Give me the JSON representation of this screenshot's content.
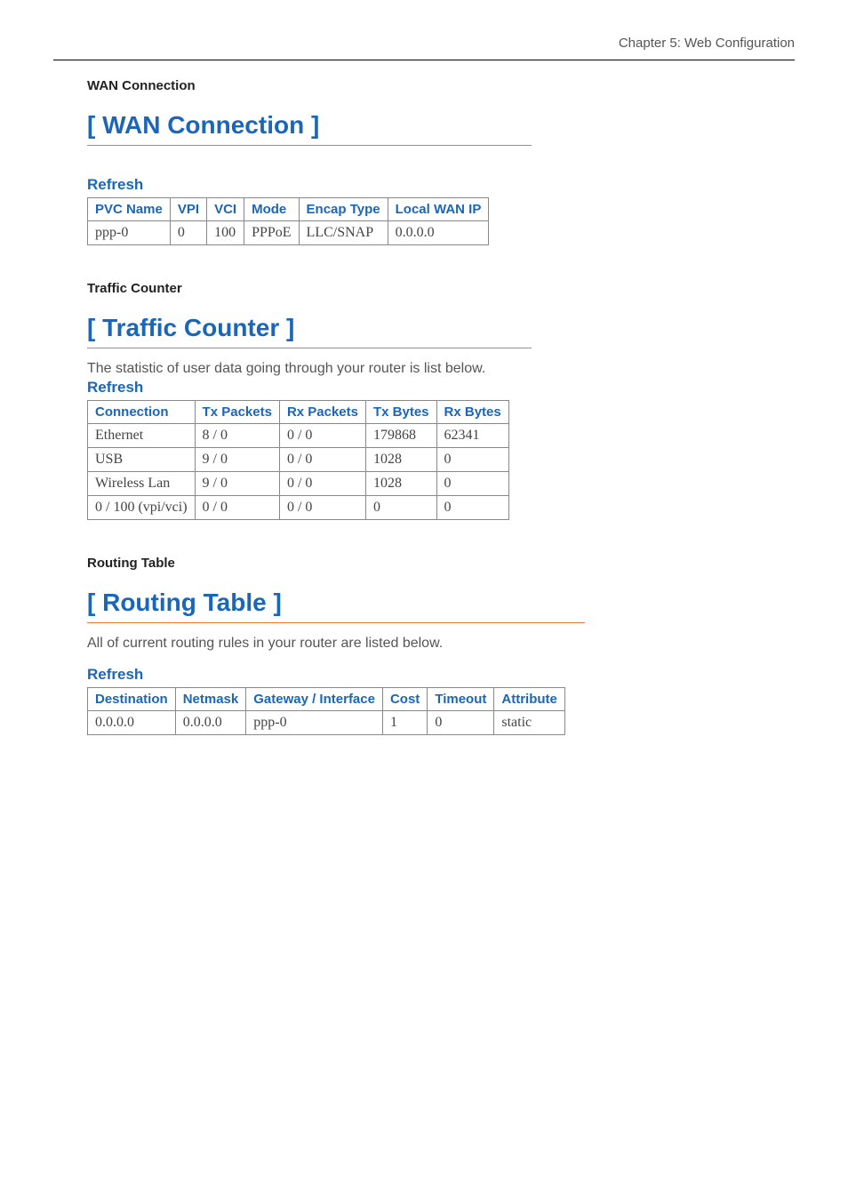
{
  "header": {
    "chapter": "Chapter 5: Web Configuration"
  },
  "wan": {
    "section_label": "WAN Connection",
    "panel_title": "[ WAN Connection ]",
    "refresh": "Refresh",
    "headers": [
      "PVC Name",
      "VPI",
      "VCI",
      "Mode",
      "Encap Type",
      "Local WAN IP"
    ],
    "rows": [
      {
        "pvc_name": "ppp-0",
        "vpi": "0",
        "vci": "100",
        "mode": "PPPoE",
        "encap": "LLC/SNAP",
        "local_ip": "0.0.0.0"
      }
    ]
  },
  "traffic": {
    "section_label": "Traffic Counter",
    "panel_title": "[ Traffic Counter ]",
    "description": "The statistic of user data going through your router is list below.",
    "refresh": "Refresh",
    "headers": [
      "Connection",
      "Tx Packets",
      "Rx Packets",
      "Tx Bytes",
      "Rx Bytes"
    ],
    "rows": [
      {
        "conn": "Ethernet",
        "txp": "8 / 0",
        "rxp": "0 / 0",
        "txb": "179868",
        "rxb": "62341"
      },
      {
        "conn": "USB",
        "txp": "9 / 0",
        "rxp": "0 / 0",
        "txb": "1028",
        "rxb": "0"
      },
      {
        "conn": "Wireless Lan",
        "txp": "9 / 0",
        "rxp": "0 / 0",
        "txb": "1028",
        "rxb": "0"
      },
      {
        "conn": "0 / 100 (vpi/vci)",
        "txp": "0 / 0",
        "rxp": "0 / 0",
        "txb": "0",
        "rxb": "0"
      }
    ]
  },
  "routing": {
    "section_label": "Routing Table",
    "panel_title": "[ Routing Table ]",
    "description": "All of current routing rules in your router are listed below.",
    "refresh": "Refresh",
    "headers": [
      "Destination",
      "Netmask",
      "Gateway / Interface",
      "Cost",
      "Timeout",
      "Attribute"
    ],
    "rows": [
      {
        "dest": "0.0.0.0",
        "mask": "0.0.0.0",
        "gw": "ppp-0",
        "cost": "1",
        "timeout": "0",
        "attr": "static"
      }
    ]
  }
}
